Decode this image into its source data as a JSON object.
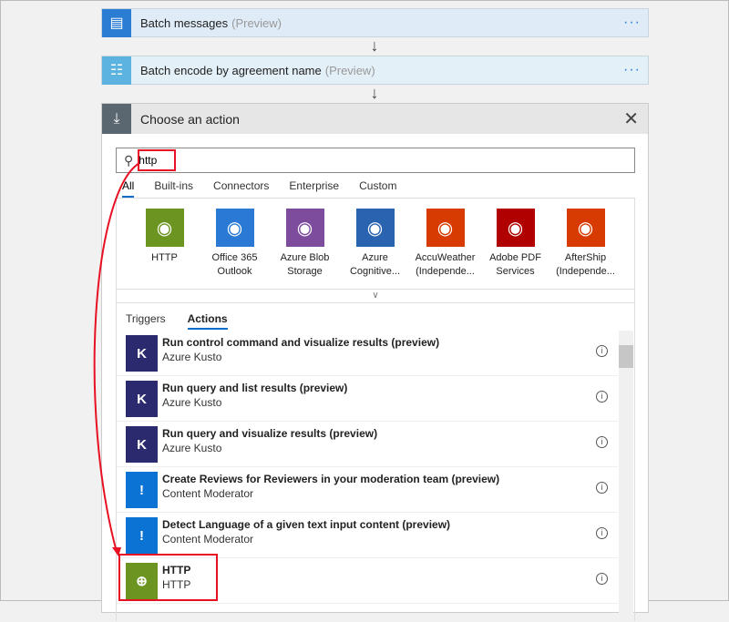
{
  "steps": [
    {
      "title": "Batch messages",
      "tag": "(Preview)",
      "icon": "batch-messages-icon",
      "color": "#2b7cd3",
      "bg": "#dfebf6"
    },
    {
      "title": "Batch encode by agreement name",
      "tag": "(Preview)",
      "icon": "batch-encode-icon",
      "color": "#5cb3e0",
      "bg": "#e3f0f8"
    }
  ],
  "panel": {
    "title": "Choose an action",
    "search_value": "http",
    "tabs": [
      "All",
      "Built-ins",
      "Connectors",
      "Enterprise",
      "Custom"
    ],
    "connectors": [
      {
        "l1": "HTTP",
        "l2": "",
        "color": "#6b9420",
        "icon": "globe-icon"
      },
      {
        "l1": "Office 365",
        "l2": "Outlook",
        "color": "#2a7ad5",
        "icon": "outlook-icon"
      },
      {
        "l1": "Azure Blob",
        "l2": "Storage",
        "color": "#7d4c9c",
        "icon": "blob-storage-icon"
      },
      {
        "l1": "Azure",
        "l2": "Cognitive...",
        "color": "#2a64b1",
        "icon": "cognitive-icon"
      },
      {
        "l1": "AccuWeather",
        "l2": "(Independe...",
        "color": "#d83b01",
        "icon": "people-icon"
      },
      {
        "l1": "Adobe PDF",
        "l2": "Services",
        "color": "#b00000",
        "icon": "adobe-pdf-icon"
      },
      {
        "l1": "AfterShip",
        "l2": "(Independe...",
        "color": "#d83b01",
        "icon": "people-icon"
      }
    ],
    "subtabs": [
      "Triggers",
      "Actions"
    ],
    "actions": [
      {
        "name": "Run control command and visualize results (preview)",
        "sub": "Azure Kusto",
        "color": "#2c2a6e",
        "glyph": "K"
      },
      {
        "name": "Run query and list results (preview)",
        "sub": "Azure Kusto",
        "color": "#2c2a6e",
        "glyph": "K"
      },
      {
        "name": "Run query and visualize results (preview)",
        "sub": "Azure Kusto",
        "color": "#2c2a6e",
        "glyph": "K"
      },
      {
        "name": "Create Reviews for Reviewers in your moderation team (preview)",
        "sub": "Content Moderator",
        "color": "#0a73d4",
        "glyph": "!"
      },
      {
        "name": "Detect Language of a given text input content (preview)",
        "sub": "Content Moderator",
        "color": "#0a73d4",
        "glyph": "!"
      },
      {
        "name": "HTTP",
        "sub": "HTTP",
        "color": "#6b9420",
        "glyph": "⊕"
      }
    ]
  },
  "annotation_color": "#e81123"
}
